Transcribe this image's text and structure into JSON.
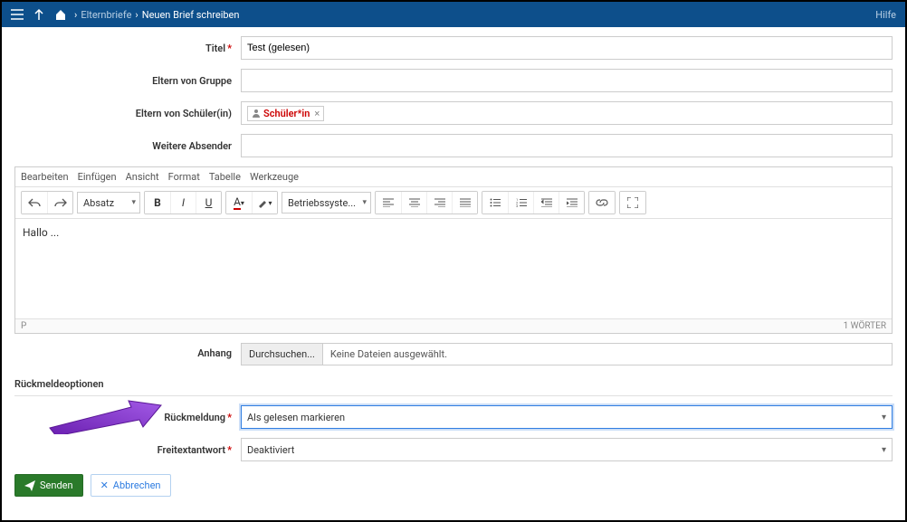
{
  "topbar": {
    "breadcrumb_parent": "Elternbriefe",
    "breadcrumb_current": "Neuen Brief schreiben",
    "help": "Hilfe"
  },
  "form": {
    "title_label": "Titel",
    "title_value": "Test (gelesen)",
    "group_label": "Eltern von Gruppe",
    "group_value": "",
    "student_label": "Eltern von Schüler(in)",
    "student_tag": "Schüler*in",
    "sender_label": "Weitere Absender",
    "sender_value": ""
  },
  "editor": {
    "menu": {
      "edit": "Bearbeiten",
      "insert": "Einfügen",
      "view": "Ansicht",
      "format": "Format",
      "table": "Tabelle",
      "tools": "Werkzeuge"
    },
    "paragraph_select": "Absatz",
    "font_select": "Betriebssyste...",
    "body": "Hallo ...",
    "status_path": "P",
    "word_count": "1 WÖRTER"
  },
  "attachment": {
    "label": "Anhang",
    "browse": "Durchsuchen...",
    "none": "Keine Dateien ausgewählt."
  },
  "feedback": {
    "section": "Rückmeldeoptionen",
    "rueck_label": "Rückmeldung",
    "rueck_value": "Als gelesen markieren",
    "freitext_label": "Freitextantwort",
    "freitext_value": "Deaktiviert"
  },
  "buttons": {
    "send": "Senden",
    "cancel": "Abbrechen"
  }
}
